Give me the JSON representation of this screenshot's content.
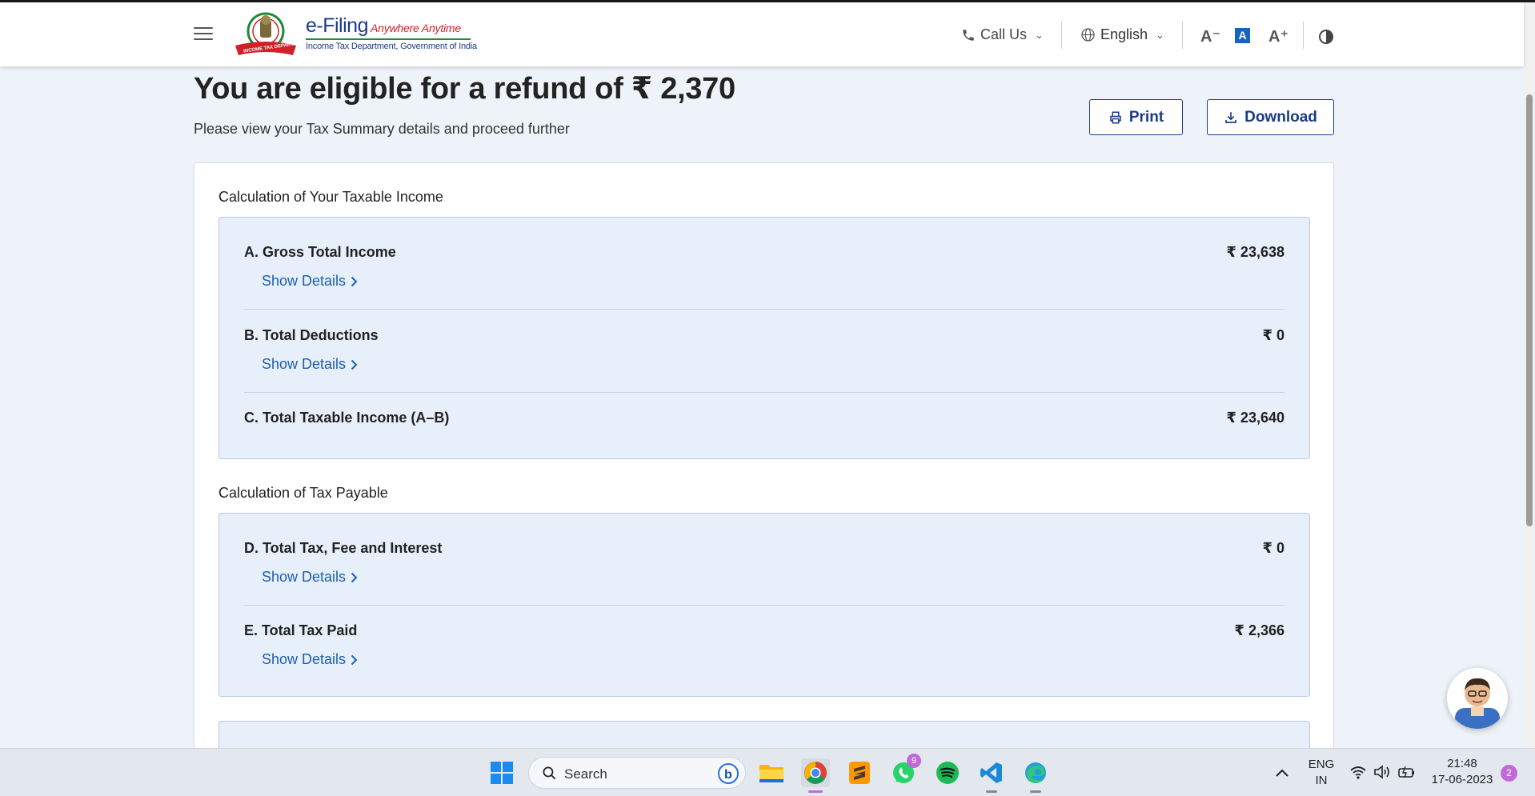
{
  "header": {
    "brand_main": "e-Filing",
    "brand_tag": "Anywhere Anytime",
    "brand_sub": "Income Tax Department, Government of India",
    "emblem_text": "INCOME TAX DEPARTMENT",
    "call_us": "Call Us",
    "language": "English",
    "font_decrease": "A⁻",
    "font_default": "A",
    "font_increase": "A⁺"
  },
  "main": {
    "title": "You are eligible for a refund of ₹ 2,370",
    "subtitle": "Please view your Tax Summary details and proceed further",
    "print_label": "Print",
    "download_label": "Download"
  },
  "income_section": {
    "title": "Calculation of Your Taxable Income",
    "rows": [
      {
        "label": "A. Gross Total Income",
        "value": "₹ 23,638",
        "details": "Show Details"
      },
      {
        "label": "B. Total Deductions",
        "value": "₹ 0",
        "details": "Show Details"
      },
      {
        "label": "C. Total Taxable Income (A–B)",
        "value": "₹ 23,640"
      }
    ]
  },
  "tax_section": {
    "title": "Calculation of Tax Payable",
    "rows": [
      {
        "label": "D. Total Tax, Fee and Interest",
        "value": "₹ 0",
        "details": "Show Details"
      },
      {
        "label": "E. Total Tax Paid",
        "value": "₹ 2,366",
        "details": "Show Details"
      }
    ]
  },
  "taskbar": {
    "search_label": "Search",
    "whatsapp_badge": "9",
    "lang_line1": "ENG",
    "lang_line2": "IN",
    "time": "21:48",
    "date": "17-06-2023",
    "notifications": "2"
  },
  "colors": {
    "brand_blue": "#1a3b8a",
    "link_blue": "#1a5fb4",
    "panel_bg": "#e7effa",
    "page_bg": "#eef3f9"
  }
}
